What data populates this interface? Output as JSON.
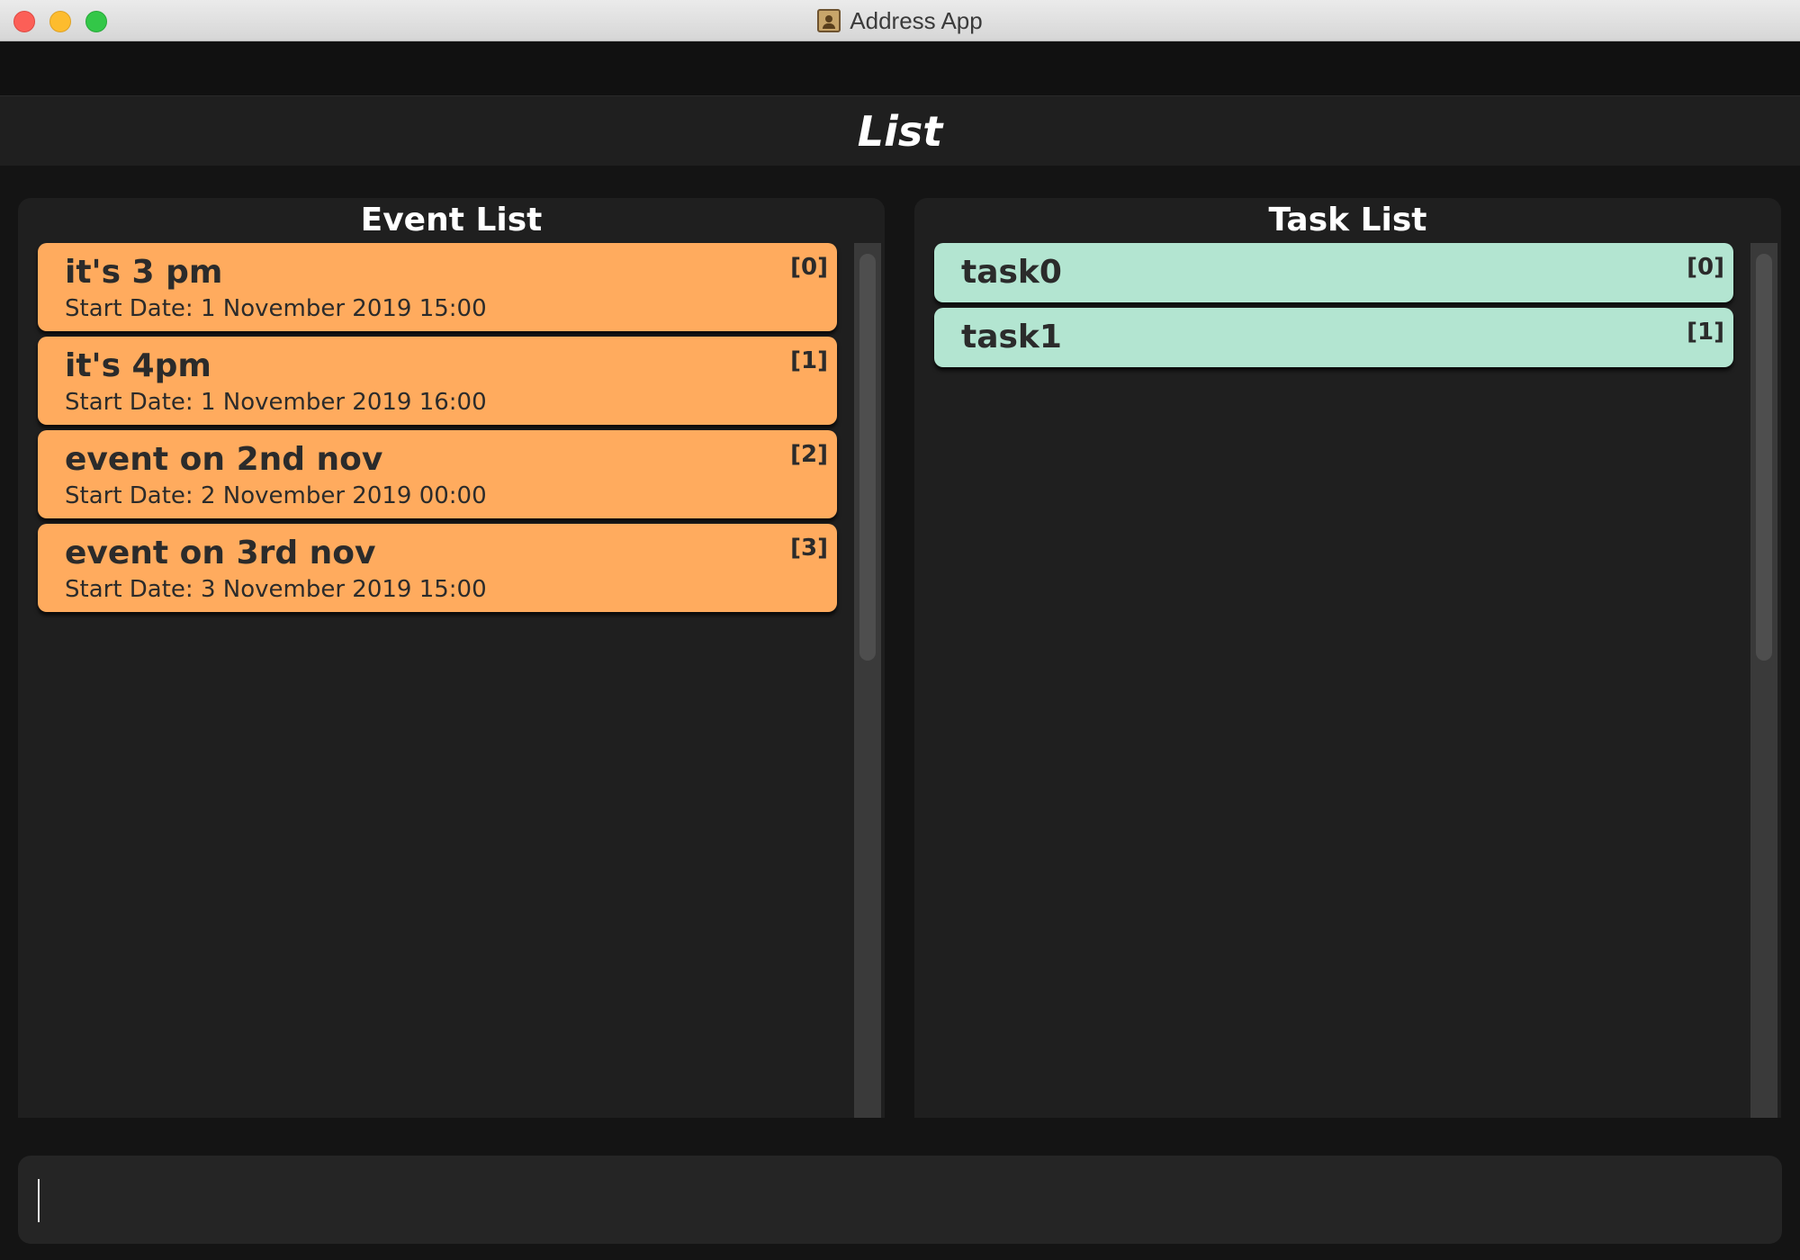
{
  "window": {
    "title": "Address App",
    "icon": "address-book-icon"
  },
  "header": {
    "title": "List"
  },
  "event_panel": {
    "title": "Event List",
    "items": [
      {
        "name": "it's 3 pm",
        "start_date": "Start Date: 1 November 2019 15:00",
        "index": "[0]"
      },
      {
        "name": "it's 4pm",
        "start_date": "Start Date: 1 November 2019 16:00",
        "index": "[1]"
      },
      {
        "name": "event on 2nd nov",
        "start_date": "Start Date: 2 November 2019 00:00",
        "index": "[2]"
      },
      {
        "name": "event on 3rd nov",
        "start_date": "Start Date: 3 November 2019 15:00",
        "index": "[3]"
      }
    ]
  },
  "task_panel": {
    "title": "Task List",
    "items": [
      {
        "name": "task0",
        "index": "[0]"
      },
      {
        "name": "task1",
        "index": "[1]"
      }
    ]
  },
  "command": {
    "value": "",
    "placeholder": ""
  },
  "colors": {
    "event_card": "#ffab5e",
    "task_card": "#b3e5d1",
    "background": "#141414",
    "panel": "#1f1f1f"
  }
}
